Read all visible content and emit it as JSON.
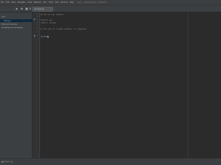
{
  "menubar": {
    "items": [
      "File",
      "Edit",
      "View",
      "Navigate",
      "Code",
      "Refactor",
      "Run",
      "Tools",
      "VCS",
      "Window",
      "Help"
    ],
    "path": "sum - ~/sum/main.py - PyCharm"
  },
  "toolbar": {
    "tab_label": "main.py"
  },
  "project": {
    "rows": [
      "sum",
      "main.py",
      "External Libraries",
      "Scratches and Consoles"
    ]
  },
  "editor": {
    "line_numbers": [
      "1",
      "2",
      "3",
      "4",
      "5",
      "6",
      "7",
      "8"
    ],
    "lines": [
      {
        "cls": "comment",
        "text": "# sum of two numbers"
      },
      {
        "cls": "comment",
        "text": ""
      },
      {
        "cls": "comment",
        "text": "import sys"
      },
      {
        "cls": "comment",
        "text": "import random"
      },
      {
        "cls": "comment",
        "text": ""
      },
      {
        "cls": "comment",
        "text": "# the sum of random numbers is computed"
      },
      {
        "cls": "comment",
        "text": ""
      },
      {
        "cls": "code",
        "text": "print("
      }
    ]
  },
  "statusbar": {
    "label": "Event Log"
  },
  "colors": {
    "editor_bg": "#2b2b2b",
    "panel_bg": "#3c3f41",
    "selection": "#0d293e",
    "keyword": "#cc7832"
  }
}
